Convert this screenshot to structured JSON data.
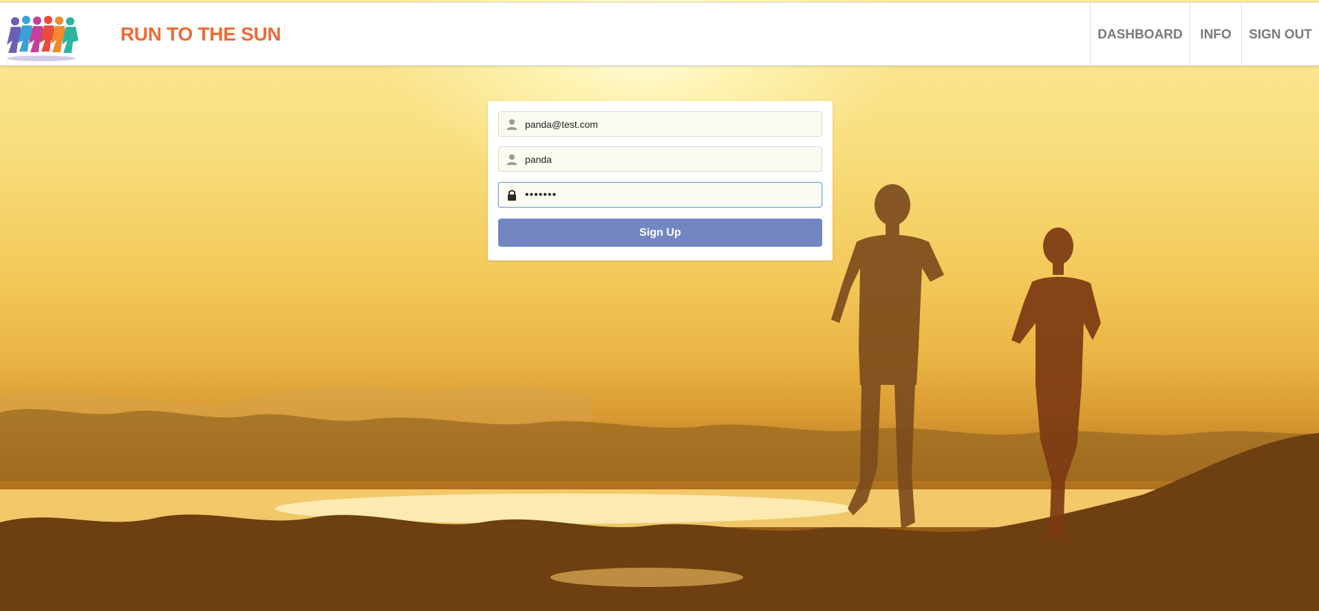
{
  "navbar": {
    "brand": "RUN TO THE SUN",
    "logo_icon": "runners-logo-icon",
    "items": [
      {
        "label": "DASHBOARD"
      },
      {
        "label": "INFO"
      },
      {
        "label": "SIGN OUT"
      }
    ]
  },
  "form": {
    "email": {
      "value": "panda@test.com",
      "icon": "user-icon"
    },
    "username": {
      "value": "panda",
      "icon": "user-icon"
    },
    "password": {
      "value": "1234567",
      "icon": "lock-icon"
    },
    "submit_label": "Sign Up"
  },
  "colors": {
    "brand": "#ee6b36",
    "button": "#7286c2",
    "nav_text": "#7a7a7a"
  }
}
